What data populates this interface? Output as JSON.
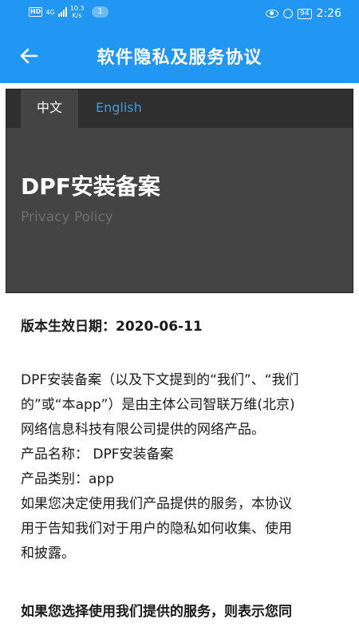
{
  "status_bar": {
    "hd": "HD",
    "network": "4G",
    "speed_value": "10.3",
    "speed_unit": "K/s",
    "notification_count": "1",
    "battery": "94",
    "time": "2:26"
  },
  "app_bar": {
    "back_icon": "arrow-left-icon",
    "title": "软件隐私及服务协议"
  },
  "tabs": [
    {
      "label": "中文",
      "active": true
    },
    {
      "label": "English",
      "active": false
    }
  ],
  "hero": {
    "title": "DPF安装备案",
    "subtitle": "Privacy Policy"
  },
  "body": {
    "effective_date": "版本生效日期：2020-06-11",
    "paragraph_lines": [
      "DPF安装备案（以及下文提到的“我们”、“我们",
      "的”或“本app”）是由主体公司智联万维(北京)",
      "网络信息科技有限公司提供的网络产品。",
      "产品名称： DPF安装备案",
      "产品类别：app",
      "如果您决定使用我们产品提供的服务，本协议",
      "用于告知我们对于用户的隐私如何收集、使用",
      "和披露。"
    ],
    "bold_line": "如果您选择使用我们提供的服务，则表示您同"
  },
  "colors": {
    "primary": "#2196F3",
    "hero_bg": "#444444",
    "tab_bar_bg": "#2f2f2f",
    "tab_inactive": "#3f9ae6"
  }
}
